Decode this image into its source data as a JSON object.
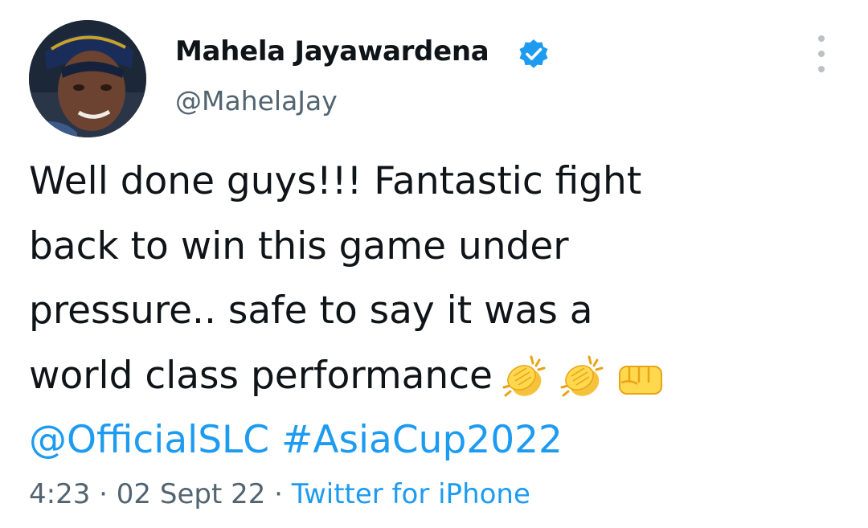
{
  "author": {
    "name": "Mahela Jayawardena",
    "handle": "@MahelaJay",
    "verified_color": "#1d9bf0"
  },
  "tweet": {
    "lines": [
      "Well done guys!!! Fantastic fight",
      "back to win this game under",
      "pressure.. safe to say it was a",
      "world class performance"
    ],
    "emojis": [
      "clapping-hands",
      "clapping-hands",
      "oncoming-fist"
    ],
    "mention": "@OfficialSLC",
    "hashtag": "#AsiaCup2022"
  },
  "meta": {
    "time": "4:23",
    "separator": "·",
    "date": "02 Sept 22",
    "source": "Twitter for iPhone"
  },
  "colors": {
    "text": "#0f1419",
    "secondary": "#536471",
    "link": "#1d9bf0"
  }
}
